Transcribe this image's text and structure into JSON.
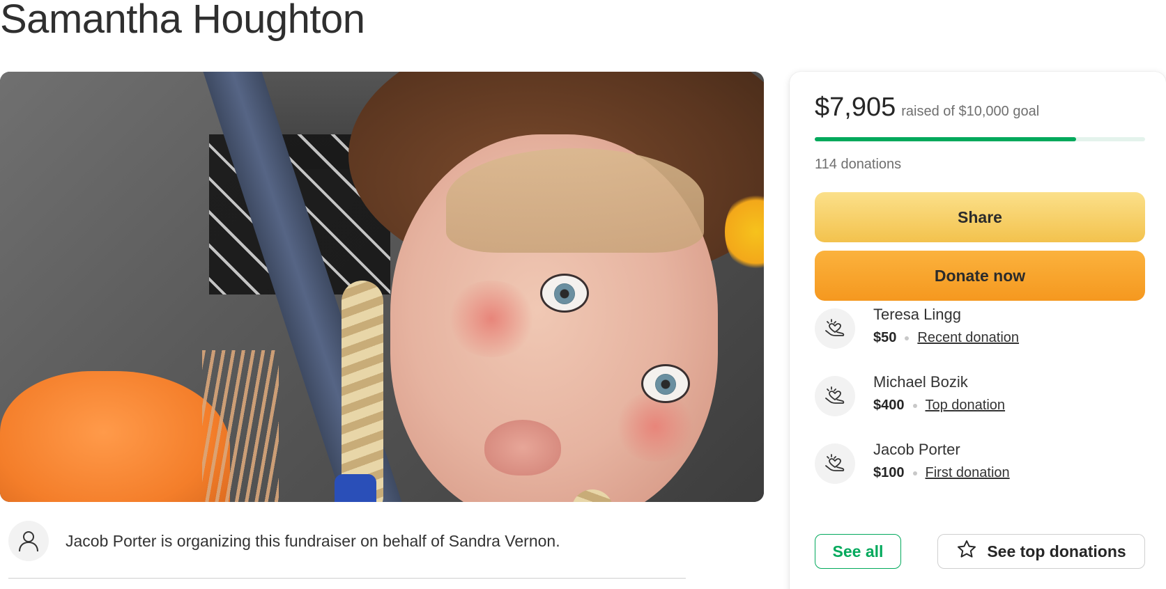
{
  "campaign": {
    "title": "Samantha Houghton"
  },
  "organizer": {
    "text": "Jacob Porter is organizing this fundraiser on behalf of Sandra Vernon.",
    "icon": "user-icon"
  },
  "progress": {
    "raised": "$7,905",
    "goal_text": "raised of $10,000 goal",
    "fraction": 0.7905,
    "donations": "114 donations",
    "bar_color": "#02a95c",
    "track_color": "#e4f3ec"
  },
  "actions": {
    "share_label": "Share",
    "donate_label": "Donate now"
  },
  "donors": [
    {
      "name": "Teresa Lingg",
      "amount": "$50",
      "tag": "Recent donation",
      "icon": "heart-hand-icon"
    },
    {
      "name": "Michael Bozik",
      "amount": "$400",
      "tag": "Top donation",
      "icon": "heart-hand-icon"
    },
    {
      "name": "Jacob Porter",
      "amount": "$100",
      "tag": "First donation",
      "icon": "heart-hand-icon"
    }
  ],
  "footer_buttons": {
    "see_all": "See all",
    "see_top": "See top donations",
    "see_top_icon": "star-icon"
  },
  "colors": {
    "accent_green": "#02a95c",
    "share_yellow": "#f3c24d",
    "donate_orange": "#f5981f"
  }
}
